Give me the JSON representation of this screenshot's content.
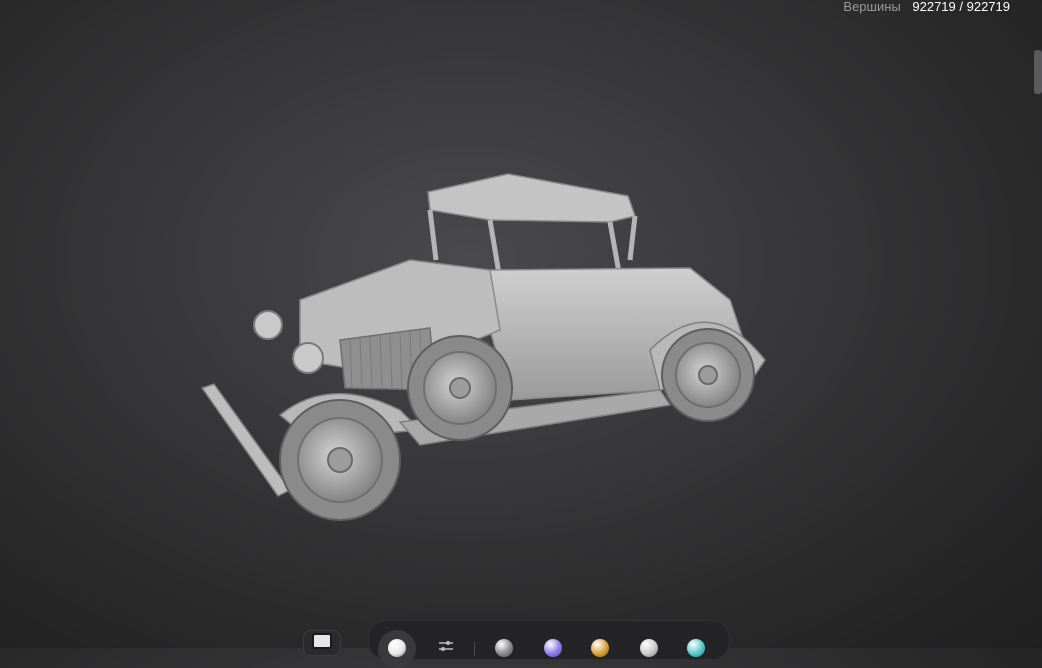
{
  "stats": {
    "label": "Вершины",
    "value": "922719 / 922719"
  },
  "toolbar": {
    "materials": [
      {
        "name": "white-clay",
        "color": "#e8e8e8"
      },
      {
        "name": "gray",
        "color": "#8a8a8c"
      },
      {
        "name": "blue-purple",
        "color": "#8d7bf0"
      },
      {
        "name": "gold",
        "color": "#d9a13a"
      },
      {
        "name": "chrome",
        "color": "#c9c9c9"
      },
      {
        "name": "cyan",
        "color": "#58c9c9"
      }
    ]
  }
}
